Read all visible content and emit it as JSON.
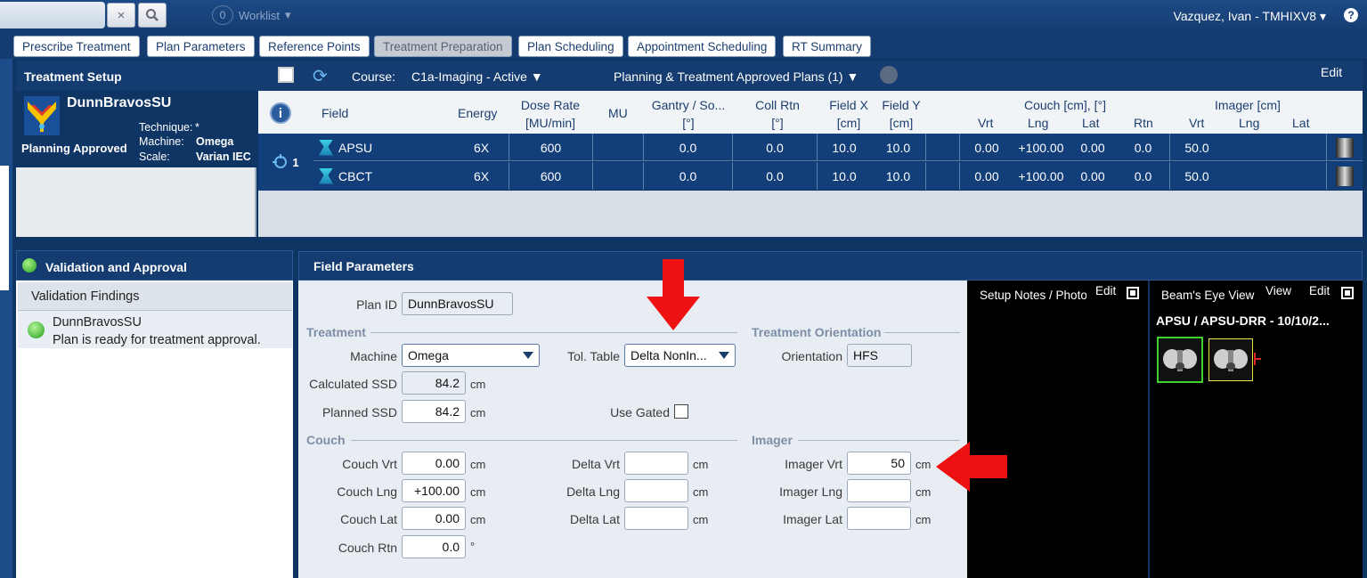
{
  "topbar": {
    "clear_glyph": "×",
    "search_glyph": "🔍",
    "worklist_count": "0",
    "worklist_label": "Worklist",
    "worklist_caret": "▾",
    "user": "Vazquez, Ivan - TMHIXV8 ▾",
    "help_glyph": "?"
  },
  "tabs": [
    {
      "label": "Prescribe Treatment"
    },
    {
      "label": "Plan Parameters"
    },
    {
      "label": "Reference Points"
    },
    {
      "label": "Treatment Preparation"
    },
    {
      "label": "Plan Scheduling"
    },
    {
      "label": "Appointment Scheduling"
    },
    {
      "label": "RT Summary"
    }
  ],
  "setup": {
    "title": "Treatment Setup",
    "course_label": "Course:",
    "course_value": "C1a-Imaging  -  Active  ▼",
    "plans_value": "Planning & Treatment Approved Plans (1)  ▼",
    "edit": "Edit",
    "refresh_glyph": "⟳"
  },
  "patient": {
    "plan_name": "DunnBravosSU",
    "technique_label": "Technique:",
    "technique_value": "*",
    "machine_label": "Machine:",
    "machine_value": "Omega",
    "scale_label": "Scale:",
    "scale_value": "Varian IEC",
    "status": "Planning Approved"
  },
  "grid": {
    "info_glyph": "i",
    "headers": {
      "field": "Field",
      "energy": "Energy",
      "dose_rate_1": "Dose Rate",
      "dose_rate_2": "[MU/min]",
      "mu": "MU",
      "gantry_1": "Gantry / So...",
      "gantry_2": "[°]",
      "coll_1": "Coll Rtn",
      "coll_2": "[°]",
      "fx_1": "Field X",
      "fx_2": "[cm]",
      "fy_1": "Field Y",
      "fy_2": "[cm]",
      "couch_group": "Couch [cm], [°]",
      "couch_vrt": "Vrt",
      "couch_lng": "Lng",
      "couch_lat": "Lat",
      "couch_rtn": "Rtn",
      "imager_group": "Imager [cm]",
      "imager_vrt": "Vrt",
      "imager_lng": "Lng",
      "imager_lat": "Lat"
    },
    "group_label": "1",
    "rows": [
      {
        "field": "APSU",
        "energy": "6X",
        "dose_rate": "600",
        "mu": "",
        "gantry": "0.0",
        "coll": "0.0",
        "fx": "10.0",
        "fy": "10.0",
        "cvrt": "0.00",
        "clng": "+100.00",
        "clat": "0.00",
        "crtn": "0.0",
        "ivrt": "50.0",
        "ilng": "",
        "ilat": ""
      },
      {
        "field": "CBCT",
        "energy": "6X",
        "dose_rate": "600",
        "mu": "",
        "gantry": "0.0",
        "coll": "0.0",
        "fx": "10.0",
        "fy": "10.0",
        "cvrt": "0.00",
        "clng": "+100.00",
        "clat": "0.00",
        "crtn": "0.0",
        "ivrt": "50.0",
        "ilng": "",
        "ilat": ""
      }
    ]
  },
  "validation": {
    "title": "Validation and Approval",
    "findings_title": "Validation Findings",
    "item_name": "DunnBravosSU",
    "item_message": "Plan is ready for treatment approval."
  },
  "field_params": {
    "title": "Field Parameters",
    "plan_id_label": "Plan ID",
    "plan_id_value": "DunnBravosSU",
    "treatment_section": "Treatment",
    "orientation_section": "Treatment Orientation",
    "machine_label": "Machine",
    "machine_value": "Omega",
    "tol_table_label": "Tol. Table",
    "tol_table_value": "Delta NonIn...",
    "orientation_label": "Orientation",
    "orientation_value": "HFS",
    "calc_ssd_label": "Calculated SSD",
    "calc_ssd_value": "84.2",
    "planned_ssd_label": "Planned SSD",
    "planned_ssd_value": "84.2",
    "use_gated_label": "Use Gated",
    "couch_section": "Couch",
    "imager_section": "Imager",
    "couch_vrt_label": "Couch Vrt",
    "couch_vrt_value": "0.00",
    "couch_lng_label": "Couch Lng",
    "couch_lng_value": "+100.00",
    "couch_lat_label": "Couch Lat",
    "couch_lat_value": "0.00",
    "couch_rtn_label": "Couch Rtn",
    "couch_rtn_value": "0.0",
    "delta_vrt_label": "Delta Vrt",
    "delta_lng_label": "Delta Lng",
    "delta_lat_label": "Delta Lat",
    "imager_vrt_label": "Imager Vrt",
    "imager_vrt_value": "50",
    "imager_lng_label": "Imager Lng",
    "imager_lat_label": "Imager Lat",
    "unit_cm": "cm",
    "unit_deg": "°"
  },
  "notes_panel": {
    "title": "Setup Notes / Photo",
    "edit": "Edit"
  },
  "bev_panel": {
    "title": "Beam's Eye View",
    "view": "View",
    "edit": "Edit",
    "image_label": "APSU / APSU-DRR - 10/10/2..."
  },
  "colors": {
    "header_blue": "#143c70",
    "row_blue": "#123e7a",
    "arrow_red": "#ee1111",
    "ok_green": "#25a31c"
  }
}
